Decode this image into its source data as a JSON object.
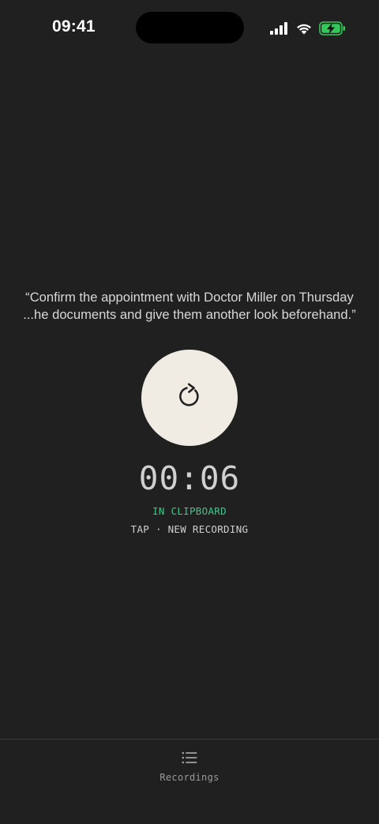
{
  "status_bar": {
    "time": "09:41",
    "icons": [
      "cellular-signal-icon",
      "wifi-icon",
      "battery-charging-icon"
    ],
    "battery_color": "#34c759"
  },
  "transcript": {
    "line1": "“Confirm the appointment with Doctor Miller on Thursday",
    "line2": "...he documents and give them another look beforehand.”"
  },
  "record_button": {
    "icon": "refresh-icon",
    "background": "#f0ece3"
  },
  "timer": "00:06",
  "clipboard_status": "IN CLIPBOARD",
  "clipboard_status_color": "#3ec98a",
  "hint": "TAP · NEW RECORDING",
  "tab_bar": {
    "recordings": {
      "label": "Recordings",
      "icon": "list-icon"
    }
  }
}
